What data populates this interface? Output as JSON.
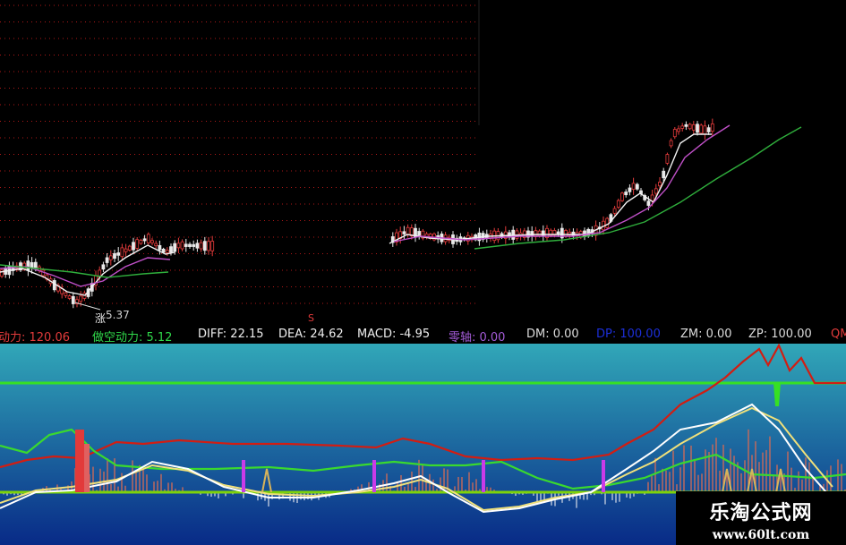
{
  "colors": {
    "up": "#e33b3b",
    "down": "#e8e8e8",
    "ma_white": "#f2f2f2",
    "ma_purple": "#c050c8",
    "ma_green": "#2fae3c",
    "grid": "#b01818",
    "osc_top": "#31a7b8",
    "osc_bottom": "#082a87",
    "zero_line": "#7dd30a",
    "upper_line": "#36e024",
    "red_line": "#d21d12",
    "green_line": "#3ad92e",
    "white_line": "#ffffff",
    "yellow_line": "#f0e07a",
    "magenta_bar": "#c93be8"
  },
  "candle_pane": {
    "low_label": "5.37",
    "low_marker": "涨",
    "signal_marker": "S"
  },
  "indicator_bar": {
    "long_label": "动力: 120.06",
    "short_label": "做空动力: 5.12",
    "diff_label": "DIFF: 22.15",
    "dea_label": "DEA: 24.62",
    "macd_label": "MACD: -4.95",
    "zero_axis_label": "零轴: 0.00",
    "dm_label": "DM: 0.00",
    "dp_label": "DP: 100.00",
    "zm_label": "ZM: 0.00",
    "zp_label": "ZP: 100.00",
    "trailing_label": "QM"
  },
  "watermark": {
    "title": "乐淘公式网",
    "url": "www.60lt.com"
  }
}
